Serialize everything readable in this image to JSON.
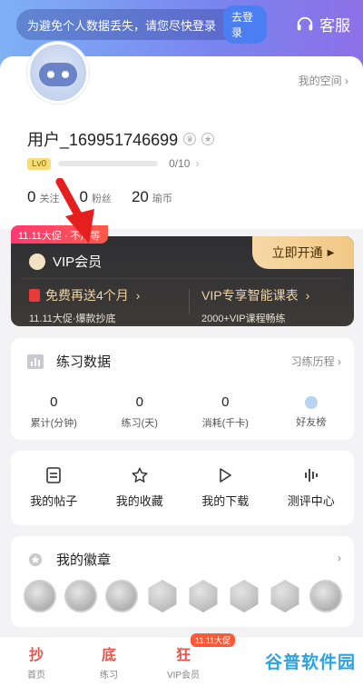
{
  "header": {
    "notice": "为避免个人数据丢失，请您尽快登录",
    "login_label": "去登录",
    "service_label": "客服"
  },
  "profile": {
    "my_space": "我的空间",
    "username": "用户_169951746699",
    "level": "Lv0",
    "progress_text": "0/10",
    "progress_fraction": 0,
    "stats": [
      {
        "value": "0",
        "label": "关注"
      },
      {
        "value": "0",
        "label": "粉丝"
      },
      {
        "value": "20",
        "label": "瑜币"
      }
    ]
  },
  "vip": {
    "tag": "11.11大促 · 不用等",
    "title": "VIP会员",
    "open_label": "立即开通",
    "left_main": "免费再送4个月",
    "left_sub": "11.11大促·爆款抄底",
    "right_main": "VIP专享智能课表",
    "right_sub": "2000+VIP课程畅练"
  },
  "practice": {
    "title": "练习数据",
    "more": "习练历程",
    "metrics": [
      {
        "value": "0",
        "label": "累计(分钟)"
      },
      {
        "value": "0",
        "label": "练习(天)"
      },
      {
        "value": "0",
        "label": "消耗(千卡)"
      },
      {
        "value": "",
        "label": "好友榜"
      }
    ]
  },
  "quick_links": [
    {
      "label": "我的帖子",
      "icon": "document-icon"
    },
    {
      "label": "我的收藏",
      "icon": "star-icon"
    },
    {
      "label": "我的下载",
      "icon": "play-icon"
    },
    {
      "label": "测评中心",
      "icon": "waveform-icon"
    }
  ],
  "badges": {
    "title": "我的徽章"
  },
  "tabbar": {
    "items": [
      {
        "icon_text": "抄",
        "label": "首页"
      },
      {
        "icon_text": "底",
        "label": "练习"
      },
      {
        "icon_text": "狂",
        "label": "VIP会员"
      }
    ],
    "flag": "11.11大促"
  },
  "watermark": "谷普软件园",
  "colors": {
    "accent": "#7a84ef",
    "vip_gold": "#f1c886",
    "promo_red": "#ff3a73"
  }
}
